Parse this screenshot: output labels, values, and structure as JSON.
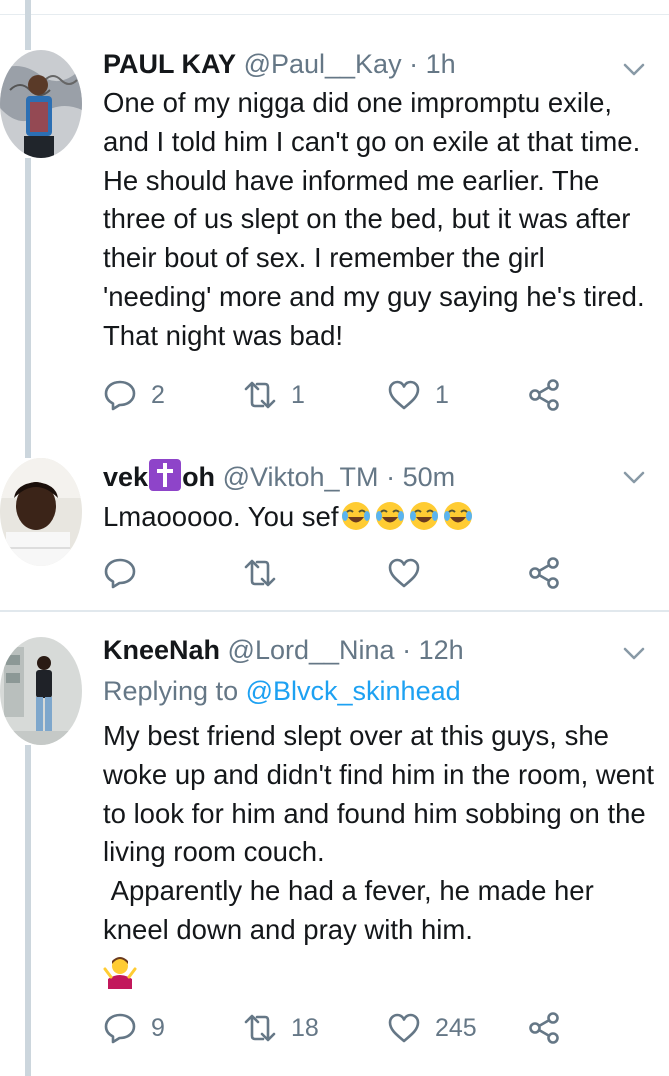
{
  "tweets": [
    {
      "name": "PAUL KAY",
      "handle": "@Paul__Kay",
      "time": "1h",
      "text": "One of my nigga did one impromptu exile, and I told him I can't go on exile at that time. He should have informed me earlier. The three of us slept on the bed, but it was after their bout of sex. I remember the girl 'needing' more and my guy saying he's tired. That night was bad!",
      "replies": "2",
      "retweets": "1",
      "likes": "1"
    },
    {
      "name_a": "vek",
      "name_b": "oh",
      "handle": "@Viktoh_TM",
      "time": "50m",
      "text": "Lmaooooo. You sef",
      "replies": "",
      "retweets": "",
      "likes": ""
    },
    {
      "name": "KneeNah",
      "handle": "@Lord__Nina",
      "time": "12h",
      "replying_label": "Replying to",
      "replying_handle": "@Blvck_skinhead",
      "text": "My best friend slept over at this guys, she woke up and didn't find him in the room, went to look for him and found him sobbing on the living room couch.\n Apparently he had a fever, he made her kneel down and pray with him.",
      "replies": "9",
      "retweets": "18",
      "likes": "245"
    }
  ],
  "icons": {
    "reply": "reply-icon",
    "retweet": "retweet-icon",
    "like": "heart-icon",
    "share": "share-icon",
    "more": "chevron-down-icon"
  },
  "colors": {
    "text": "#14171a",
    "muted": "#657786",
    "link": "#1da1f2",
    "thread": "#ccd6dd",
    "divider": "#e1e8ed"
  }
}
